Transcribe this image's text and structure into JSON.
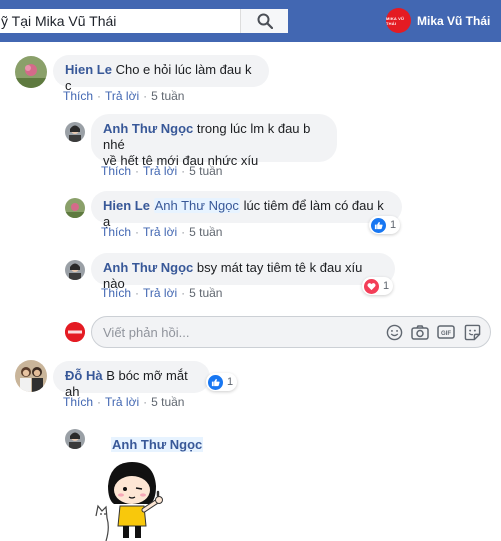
{
  "topbar": {
    "search_value": "ỹ Tại Mika Vũ Thái",
    "brand_logo_text": "MIKA VŨ THÁI",
    "brand_name": "Mika Vũ Thái"
  },
  "comments": [
    {
      "author": "Hien Le",
      "text": "Cho e hỏi lúc làm đau k c",
      "like": "Thích",
      "reply": "Trả lời",
      "time": "5 tuần"
    },
    {
      "author": "Anh Thư Ngọc",
      "text_line1": "trong lúc lm k đau b nhé",
      "text_line2": "về hết tê mới đau nhức xíu",
      "like": "Thích",
      "reply": "Trả lời",
      "time": "5 tuần"
    },
    {
      "author": "Hien Le",
      "mention": "Anh Thư Ngọc",
      "text": "lúc tiêm để làm có đau k ạ",
      "like": "Thích",
      "reply": "Trả lời",
      "time": "5 tuần",
      "reaction_count": "1"
    },
    {
      "author": "Anh Thư Ngọc",
      "text": "bsy mát tay tiêm tê k đau xíu nào",
      "like": "Thích",
      "reply": "Trả lời",
      "time": "5 tuần",
      "reaction_count": "1"
    },
    {
      "author": "Đỗ Hà",
      "text": "B bóc mỡ mắt ah",
      "like": "Thích",
      "reply": "Trả lời",
      "time": "5 tuần",
      "reaction_count": "1"
    },
    {
      "author": "Anh Thư Ngọc"
    }
  ],
  "reply_box": {
    "placeholder": "Viết phản hồi...",
    "gif_label": "GIF"
  },
  "colors": {
    "topbar": "#4267b2",
    "link": "#385898",
    "bubble": "#f2f3f5",
    "like_blue": "#1877f2",
    "love_red": "#f33e58"
  },
  "icons": [
    "search-icon",
    "emoji-icon",
    "camera-icon",
    "gif-icon",
    "sticker-icon",
    "like-reaction-icon",
    "love-reaction-icon"
  ]
}
